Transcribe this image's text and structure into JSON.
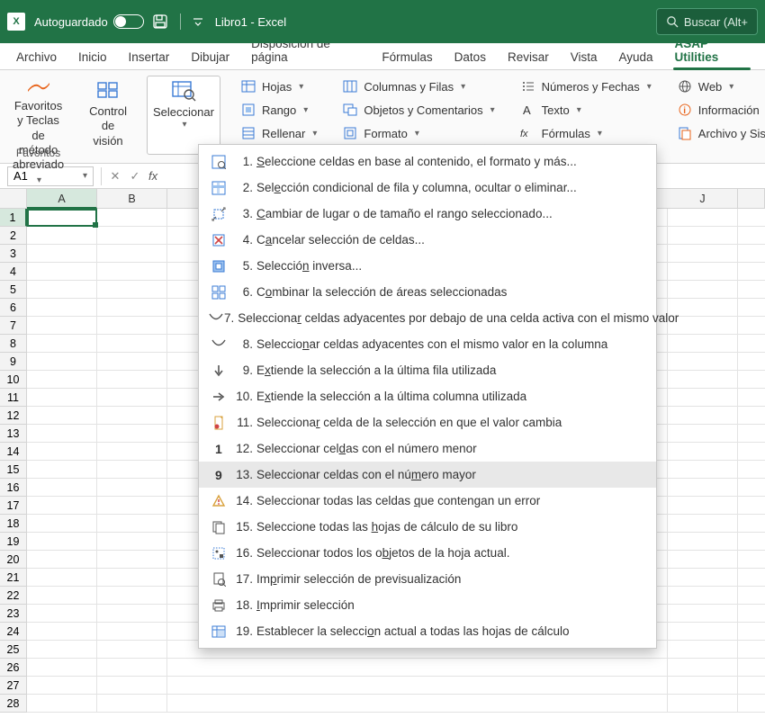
{
  "titlebar": {
    "autosave_label": "Autoguardado",
    "doc_title": "Libro1 - Excel",
    "search_placeholder": "Buscar (Alt+"
  },
  "tabs": {
    "items": [
      "Archivo",
      "Inicio",
      "Insertar",
      "Dibujar",
      "Disposición de página",
      "Fórmulas",
      "Datos",
      "Revisar",
      "Vista",
      "Ayuda",
      "ASAP Utilities"
    ],
    "active_index": 10
  },
  "ribbon": {
    "favoritos_label_line1": "Favoritos y Teclas de",
    "favoritos_label_line2": "método abreviado",
    "control_vision_line1": "Control",
    "control_vision_line2": "de visión",
    "seleccionar_label": "Seleccionar",
    "group_label_favoritos": "Favoritos",
    "col1": {
      "hojas": "Hojas",
      "rango": "Rango",
      "rellenar": "Rellenar"
    },
    "col2": {
      "columnas": "Columnas y Filas",
      "objetos": "Objetos y Comentarios",
      "formato": "Formato"
    },
    "col3": {
      "numeros": "Números y Fechas",
      "texto": "Texto",
      "formulas": "Fórmulas"
    },
    "col4": {
      "web": "Web",
      "informacion": "Información",
      "archivo": "Archivo y Sistema"
    }
  },
  "formula_bar": {
    "name_box": "A1"
  },
  "grid": {
    "columns": [
      "A",
      "B",
      "J"
    ],
    "row_count": 28
  },
  "menu": {
    "hover_index": 12,
    "items": [
      {
        "n": "1.",
        "text_before": "",
        "u": "S",
        "text_after": "eleccione celdas en base al contenido, el formato y más..."
      },
      {
        "n": "2.",
        "text_before": "Sel",
        "u": "e",
        "text_after": "cción condicional de fila y columna, ocultar o eliminar..."
      },
      {
        "n": "3.",
        "text_before": "",
        "u": "C",
        "text_after": "ambiar de lugar o de tamaño el rango seleccionado..."
      },
      {
        "n": "4.",
        "text_before": "C",
        "u": "a",
        "text_after": "ncelar selección de celdas..."
      },
      {
        "n": "5.",
        "text_before": "Selecció",
        "u": "n",
        "text_after": " inversa..."
      },
      {
        "n": "6.",
        "text_before": "C",
        "u": "o",
        "text_after": "mbinar la selección de áreas seleccionadas"
      },
      {
        "n": "7.",
        "text_before": "Selecciona",
        "u": "r",
        "text_after": " celdas adyacentes por debajo de una celda activa con el mismo valor"
      },
      {
        "n": "8.",
        "text_before": "Seleccio",
        "u": "n",
        "text_after": "ar celdas adyacentes con el mismo valor en la columna"
      },
      {
        "n": "9.",
        "text_before": "E",
        "u": "x",
        "text_after": "tiende la selección a la última fila utilizada"
      },
      {
        "n": "10.",
        "text_before": "E",
        "u": "x",
        "text_after": "tiende la selección a la última columna utilizada"
      },
      {
        "n": "11.",
        "text_before": "Selecciona",
        "u": "r",
        "text_after": " celda de la selección en que el valor cambia"
      },
      {
        "n": "12.",
        "text_before": "Seleccionar cel",
        "u": "d",
        "text_after": "as con el número menor"
      },
      {
        "n": "13.",
        "text_before": "Seleccionar celdas con el nú",
        "u": "m",
        "text_after": "ero mayor"
      },
      {
        "n": "14.",
        "text_before": "Seleccionar todas las celdas ",
        "u": "q",
        "text_after": "ue contengan un error"
      },
      {
        "n": "15.",
        "text_before": "Seleccione todas las ",
        "u": "h",
        "text_after": "ojas de cálculo de su libro"
      },
      {
        "n": "16.",
        "text_before": "Seleccionar todos los o",
        "u": "b",
        "text_after": "jetos de la hoja actual."
      },
      {
        "n": "17.",
        "text_before": "Im",
        "u": "p",
        "text_after": "rimir selección de previsualización"
      },
      {
        "n": "18.",
        "text_before": "",
        "u": "I",
        "text_after": "mprimir selección"
      },
      {
        "n": "19.",
        "text_before": "Establecer la selecci",
        "u": "o",
        "text_after": "n actual a todas las hojas de cálculo"
      }
    ]
  }
}
